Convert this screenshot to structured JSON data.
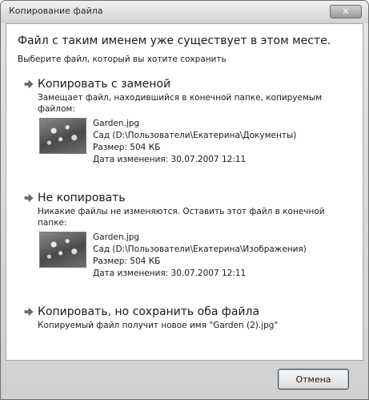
{
  "window": {
    "title": "Копирование файла",
    "close_glyph": "✕"
  },
  "heading": "Файл с таким именем уже существует в этом месте.",
  "subheading": "Выберите файл, который вы хотите сохранить",
  "options": [
    {
      "title": "Копировать с заменой",
      "description": "Замещает файл, находившийся в конечной папке, копируемым файлом:",
      "file": {
        "name": "Garden.jpg",
        "location": "Сад (D:\\Пользователи\\Екатерина\\Документы)",
        "size": "Размер: 504 КБ",
        "modified": "Дата изменения: 30.07.2007 12:11"
      }
    },
    {
      "title": "Не копировать",
      "description": "Никакие файлы не изменяются. Оставить этот файл в конечной папке:",
      "file": {
        "name": "Garden.jpg",
        "location": "Сад (D:\\Пользователи\\Екатерина\\Изображения)",
        "size": "Размер: 504 КБ",
        "modified": "Дата изменения: 30.07.2007 12:11"
      }
    },
    {
      "title": "Копировать, но сохранить оба файла",
      "description": "Копируемый файл получит новое имя \"Garden (2).jpg\""
    }
  ],
  "buttons": {
    "cancel": "Отмена"
  },
  "icons": {
    "option_arrow": "arrow-right-icon",
    "thumbnail": "image-thumbnail-icon"
  }
}
